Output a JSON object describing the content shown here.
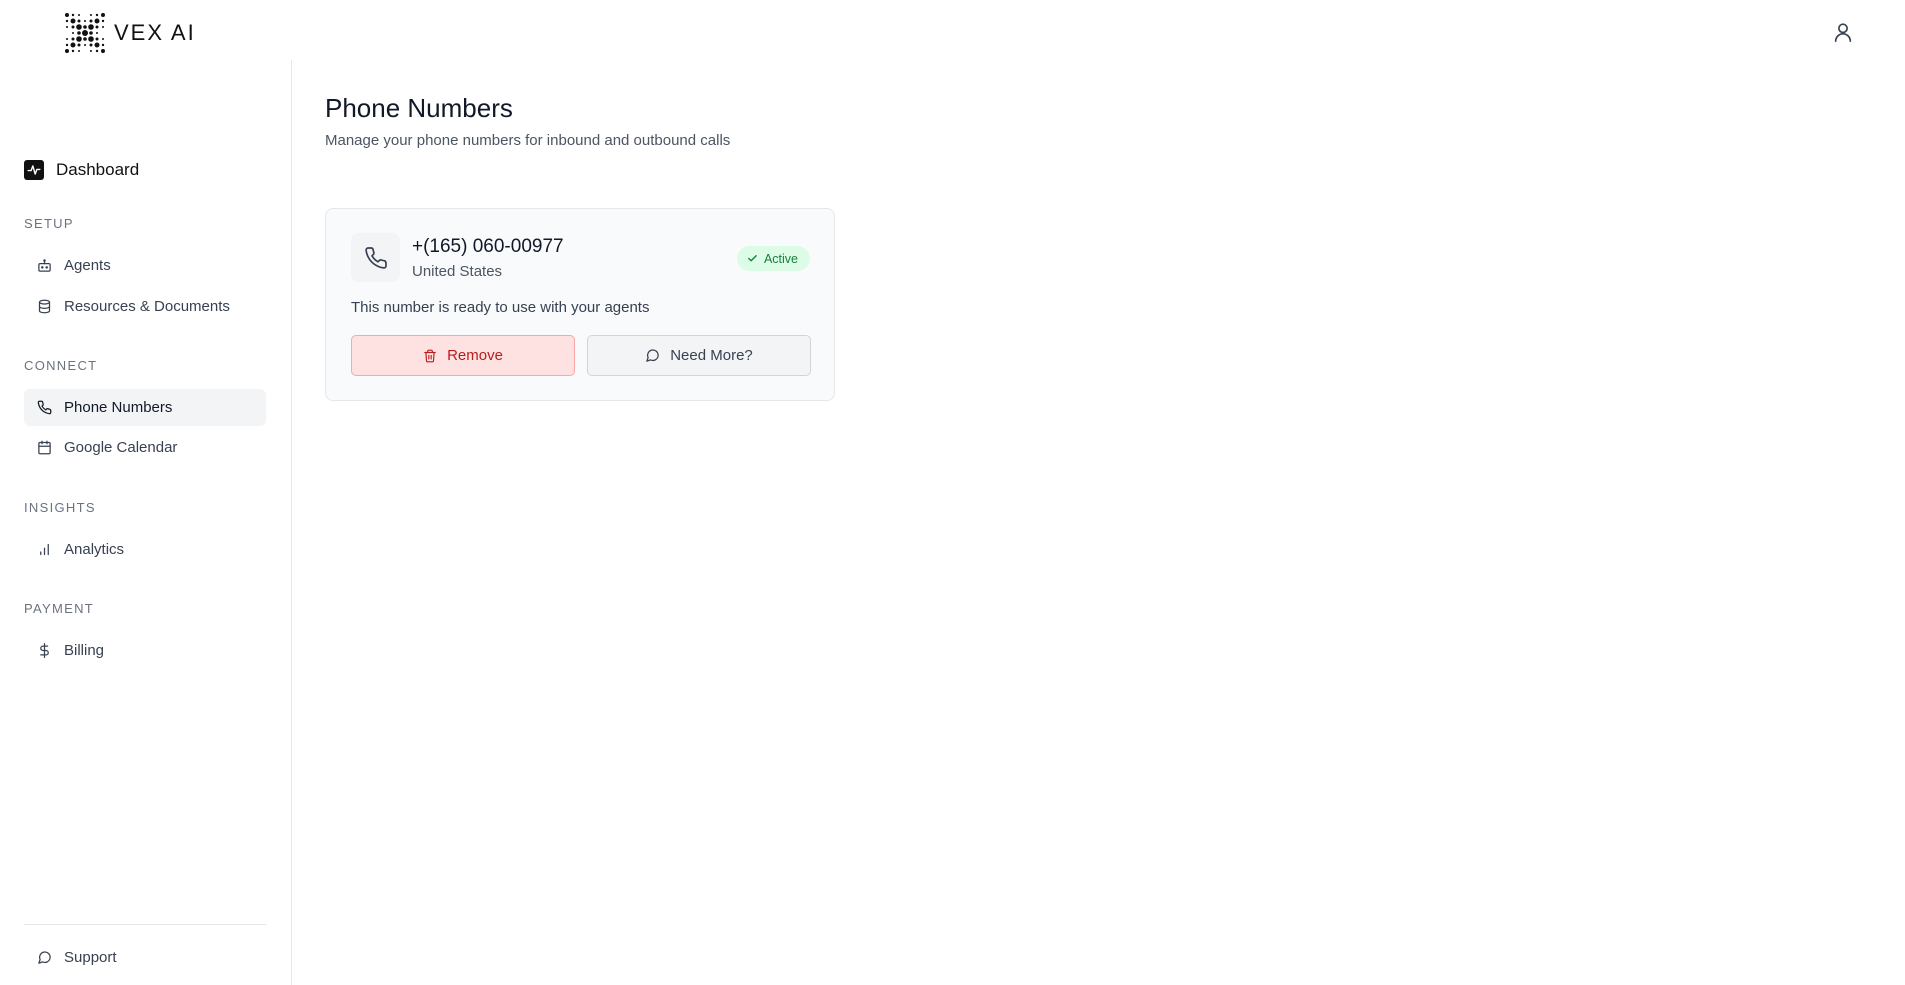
{
  "brand": {
    "name": "VEX AI"
  },
  "header": {
    "profile_icon": "user-icon"
  },
  "sidebar": {
    "dashboard": {
      "label": "Dashboard",
      "icon": "activity-icon"
    },
    "sections": [
      {
        "label": "SETUP"
      },
      {
        "label": "CONNECT"
      },
      {
        "label": "INSIGHTS"
      },
      {
        "label": "PAYMENT"
      }
    ],
    "items": [
      {
        "label": "Agents",
        "icon": "bot-icon"
      },
      {
        "label": "Resources & Documents",
        "icon": "database-icon"
      },
      {
        "label": "Phone Numbers",
        "icon": "phone-icon",
        "active": true
      },
      {
        "label": "Google Calendar",
        "icon": "calendar-icon"
      },
      {
        "label": "Analytics",
        "icon": "bar-chart-icon"
      },
      {
        "label": "Billing",
        "icon": "dollar-icon"
      }
    ],
    "support": {
      "label": "Support",
      "icon": "message-circle-icon"
    }
  },
  "main": {
    "title": "Phone Numbers",
    "subtitle": "Manage your phone numbers for inbound and outbound calls",
    "card": {
      "number": "+(165) 060-00977",
      "country": "United States",
      "status": "Active",
      "description": "This number is ready to use with your agents",
      "remove_label": "Remove",
      "more_label": "Need More?"
    }
  },
  "colors": {
    "active_badge_bg": "#dcfce7",
    "active_badge_text": "#15803d",
    "remove_bg": "#fee2e2",
    "remove_text": "#b91c1c"
  }
}
